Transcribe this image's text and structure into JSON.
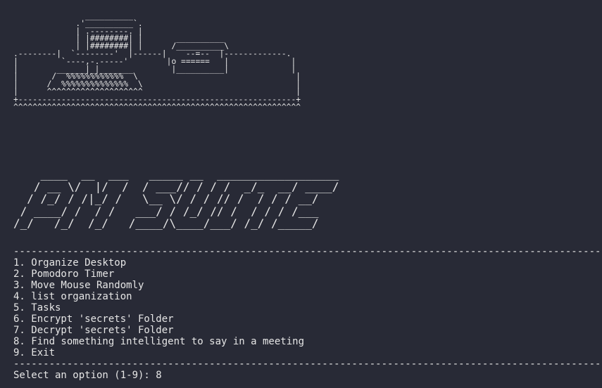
{
  "art": {
    "computer": "               __________\n             .'__________`.\n             | .--------. |\n             | |########| |       __________\n             | |########| |      /__________\\\n.--------|  `--------'  |------|    --=--  |-------------.\n|         `----,-.-----'        |o ======   |             |\n|        ______|_|_______        |__________|             |\n|       /  %%%%%%%%%%%%  \\                                 |\n|      /  %%%%%%%%%%%%%%  \\                                |\n|      ^^^^^^^^^^^^^^^^^^^^                                |\n+----------------------------------------------------------+\n^^^^^^^^^^^^^^^^^^^^^^^^^^^^^^^^^^^^^^^^^^^^^^^^^^^^^^^^^^^^",
    "title": "    ____  __  ___   _____ __  __________________\n   / __ \\/  |/  /  / ___// / / /  _/_  __/ ____/\n  / /_/ / /|_/ /   \\__ \\/ / / // /  / / / __/\n / ____/ /  / /   ___/ / /_/ // /  / / / /___\n/_/   /_/  /_/   /____/\\____/___/ /_/ /_____/"
  },
  "divider": "-----------------------------------------------------------------------------------------------------------------------------",
  "menu": {
    "items": [
      "1. Organize Desktop",
      "2. Pomodoro Timer",
      "3. Move Mouse Randomly",
      "4. list organization",
      "5. Tasks",
      "6. Encrypt 'secrets' Folder",
      "7. Decrypt 'secrets' Folder",
      "8. Find something intelligent to say in a meeting",
      "9. Exit"
    ]
  },
  "prompt": {
    "label": "Select an option (1-9): ",
    "input": "8"
  },
  "colors": {
    "background": "#282a36",
    "foreground": "#e6e6e6"
  }
}
